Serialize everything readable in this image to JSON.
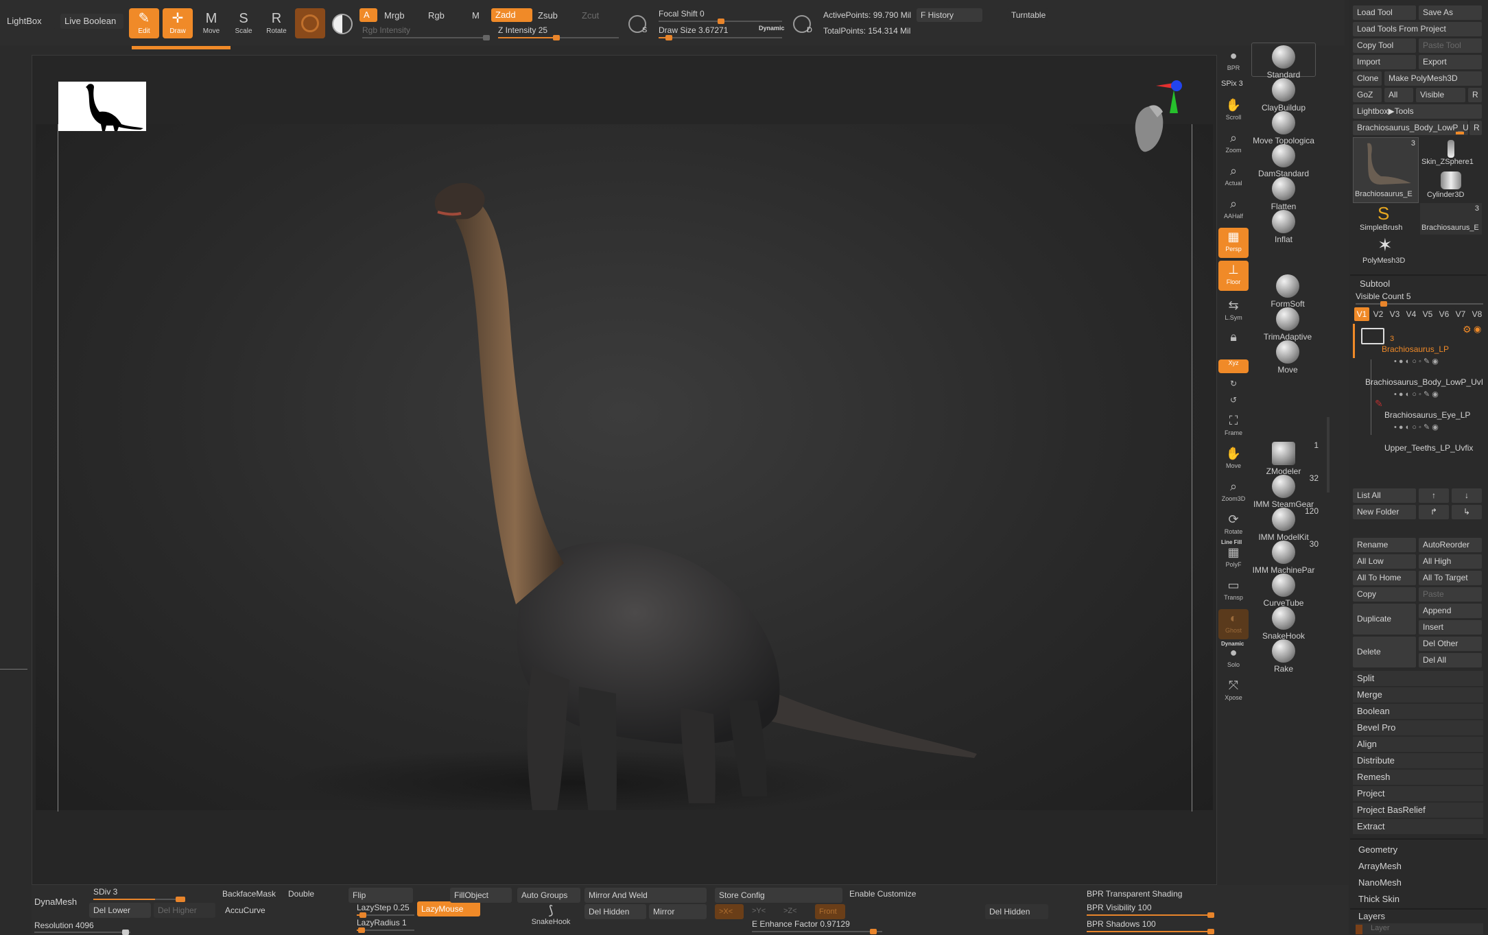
{
  "topbar": {
    "lightbox": "LightBox",
    "live_boolean": "Live Boolean",
    "tools": [
      {
        "label": "Edit",
        "icon": "edit-icon",
        "glyph": "✎",
        "active": true
      },
      {
        "label": "Draw",
        "icon": "draw-icon",
        "glyph": "✛",
        "active": true
      },
      {
        "label": "Move",
        "icon": "move-icon",
        "glyph": "M",
        "active": false
      },
      {
        "label": "Scale",
        "icon": "scale-icon",
        "glyph": "S",
        "active": false
      },
      {
        "label": "Rotate",
        "icon": "rotate-icon",
        "glyph": "R",
        "active": false
      }
    ],
    "a_label": "A",
    "mrgb": "Mrgb",
    "rgb": "Rgb",
    "m": "M",
    "rgb_intensity": "Rgb Intensity",
    "zadd": "Zadd",
    "zsub": "Zsub",
    "zcut": "Zcut",
    "z_intensity": "Z Intensity 25",
    "focal_shift": "Focal Shift 0",
    "draw_size": "Draw Size 3.67271",
    "dynamic": "Dynamic",
    "active_points": "ActivePoints: 99.790 Mil",
    "total_points": "TotalPoints: 154.314 Mil",
    "f_history": "F History",
    "turntable": "Turntable",
    "s_letter": "S",
    "d_letter": "D"
  },
  "dock": {
    "bpr": "BPR",
    "spix": "SPix 3",
    "items": [
      "Scroll",
      "Zoom",
      "Actual",
      "AAHalf",
      "Persp",
      "Floor",
      "L.Sym",
      "",
      "Xyz",
      "",
      "",
      "Frame",
      "Move",
      "Zoom3D",
      "Rotate",
      "PolyF",
      "Transp",
      "Ghost",
      "Solo",
      "Xpose"
    ],
    "dynamic_label": "Dynamic",
    "line_fill": "Line Fill"
  },
  "brushes": [
    {
      "name": "Standard",
      "count": ""
    },
    {
      "name": "ClayBuildup",
      "count": ""
    },
    {
      "name": "Move Topologica",
      "count": ""
    },
    {
      "name": "DamStandard",
      "count": ""
    },
    {
      "name": "Flatten",
      "count": ""
    },
    {
      "name": "Inflat",
      "count": ""
    },
    {
      "name": "FormSoft",
      "count": ""
    },
    {
      "name": "TrimAdaptive",
      "count": ""
    },
    {
      "name": "Move",
      "count": ""
    },
    {
      "name": "ZModeler",
      "count": "1"
    },
    {
      "name": "IMM SteamGear",
      "count": "32"
    },
    {
      "name": "IMM ModelKit",
      "count": "120"
    },
    {
      "name": "IMM MachinePar",
      "count": "30"
    },
    {
      "name": "CurveTube",
      "count": ""
    },
    {
      "name": "SnakeHook",
      "count": ""
    },
    {
      "name": "Rake",
      "count": ""
    }
  ],
  "toolpanel": {
    "load_tool": "Load Tool",
    "save_as": "Save As",
    "load_from_project": "Load Tools From Project",
    "copy_tool": "Copy Tool",
    "paste_tool": "Paste Tool",
    "import": "Import",
    "export": "Export",
    "clone": "Clone",
    "make_polymesh": "Make PolyMesh3D",
    "goz": "GoZ",
    "all": "All",
    "visible": "Visible",
    "r": "R",
    "lightbox_tools": "Lightbox▶Tools",
    "current_tool": "Brachiosaurus_Body_LowP_U",
    "r2": "R",
    "thumbs": [
      {
        "name": "Brachiosaurus_E",
        "count": "3"
      },
      {
        "name": "Skin_ZSphere1",
        "count": ""
      },
      {
        "name": "Cylinder3D",
        "count": ""
      },
      {
        "name": "SimpleBrush",
        "count": ""
      },
      {
        "name": "Brachiosaurus_E",
        "count": "3"
      },
      {
        "name": "PolyMesh3D",
        "count": ""
      }
    ],
    "subtool": "Subtool",
    "visible_count": "Visible Count 5",
    "vtabs": [
      "V1",
      "V2",
      "V3",
      "V4",
      "V5",
      "V6",
      "V7",
      "V8"
    ],
    "folder_count": "3",
    "subtools": [
      "Brachiosaurus_LP",
      "Brachiosaurus_Body_LowP_UvI",
      "Brachiosaurus_Eye_LP",
      "Upper_Teeths_LP_Uvfix"
    ],
    "list_all": "List All",
    "new_folder": "New Folder",
    "rename": "Rename",
    "autoreorder": "AutoReorder",
    "all_low": "All Low",
    "all_high": "All High",
    "all_to_home": "All To Home",
    "all_to_target": "All To Target",
    "copy": "Copy",
    "paste": "Paste",
    "duplicate": "Duplicate",
    "append": "Append",
    "insert": "Insert",
    "delete": "Delete",
    "del_other": "Del Other",
    "del_all": "Del All",
    "list": [
      "Split",
      "Merge",
      "Boolean",
      "Bevel Pro",
      "Align",
      "Distribute",
      "Remesh",
      "Project",
      "Project BasRelief",
      "Extract"
    ],
    "sections": [
      "Geometry",
      "ArrayMesh",
      "NanoMesh",
      "Thick Skin"
    ],
    "layers": "Layers",
    "layer": "Layer"
  },
  "bottombar": {
    "dynamesh": "DynaMesh",
    "sdiv": "SDiv 3",
    "del_lower": "Del Lower",
    "del_higher": "Del Higher",
    "resolution": "Resolution 4096",
    "backface": "BackfaceMask",
    "double": "Double",
    "accucurve": "AccuCurve",
    "flip": "Flip",
    "lazystep": "LazyStep 0.25",
    "lazymouse": "LazyMouse",
    "lazyradius": "LazyRadius 1",
    "fillobject": "FillObject",
    "auto_groups": "Auto Groups",
    "snakehook": "SnakeHook",
    "mirror_weld": "Mirror And Weld",
    "del_hidden": "Del Hidden",
    "mirror": "Mirror",
    "x": ">X<",
    "y": ">Y<",
    "z": ">Z<",
    "front": "Front",
    "store_config": "Store Config",
    "enable_customize": "Enable Customize",
    "enhance": "E Enhance Factor 0.97129",
    "del_hidden2": "Del Hidden",
    "bpr_trans": "BPR Transparent Shading",
    "bpr_vis": "BPR Visibility 100",
    "bpr_shadows": "BPR Shadows 100"
  },
  "colors": {
    "accent": "#f08a28",
    "panel": "#2d2d2d",
    "button": "#3a3a3a"
  }
}
